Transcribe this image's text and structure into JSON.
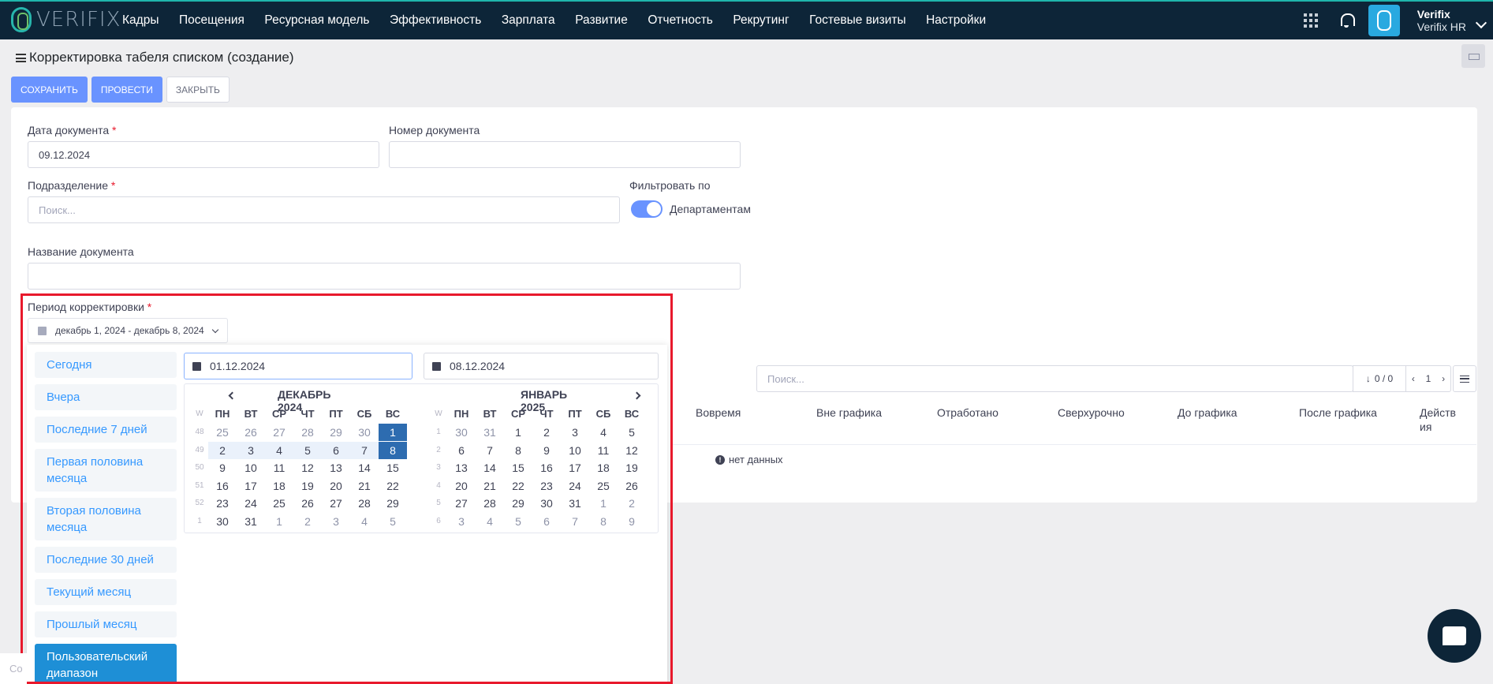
{
  "nav": {
    "logo": "VERIFIX",
    "items": [
      "Кадры",
      "Посещения",
      "Ресурсная модель",
      "Эффективность",
      "Зарплата",
      "Развитие",
      "Отчетность",
      "Рекрутинг",
      "Гостевые визиты",
      "Настройки"
    ],
    "user_name": "Verifix",
    "user_company": "Verifix HR"
  },
  "page": {
    "title": "Корректировка табеля списком (создание)",
    "save": "СОХРАНИТЬ",
    "post": "ПРОВЕСТИ",
    "close": "ЗАКРЫТЬ"
  },
  "form": {
    "doc_date_label": "Дата документа",
    "doc_date_value": "09.12.2024",
    "doc_number_label": "Номер документа",
    "doc_number_value": "",
    "division_label": "Подразделение",
    "division_placeholder": "Поиск...",
    "filter_label": "Фильтровать по",
    "filter_toggle_label": "Департаментам",
    "doc_name_label": "Название документа",
    "doc_name_value": "",
    "period_label": "Период корректировки",
    "period_value": "декабрь 1, 2024 - декабрь 8, 2024",
    "required_mark": "*"
  },
  "table": {
    "search_placeholder": "Поиск...",
    "counter": "0 / 0",
    "page": "1",
    "columns": [
      "Вовремя",
      "Вне графика",
      "Отработано",
      "Сверхурочно",
      "До графика",
      "После графика",
      "Действия"
    ],
    "empty_text": "нет данных"
  },
  "daterange": {
    "ranges": [
      "Сегодня",
      "Вчера",
      "Последние 7 дней",
      "Первая половина месяца",
      "Вторая половина месяца",
      "Последние 30 дней",
      "Текущий месяц",
      "Прошлый месяц",
      "Пользовательский диапазон"
    ],
    "active_range": "Пользовательский диапазон",
    "start": "01.12.2024",
    "end": "08.12.2024",
    "dow": [
      "W",
      "ПН",
      "ВТ",
      "СР",
      "ЧТ",
      "ПТ",
      "СБ",
      "ВС"
    ],
    "months": [
      {
        "title": "ДЕКАБРЬ 2024",
        "weeks": [
          {
            "w": "48",
            "days": [
              [
                "25",
                "off"
              ],
              [
                "26",
                "off"
              ],
              [
                "27",
                "off"
              ],
              [
                "28",
                "off"
              ],
              [
                "29",
                "off"
              ],
              [
                "30",
                "off"
              ],
              [
                "1",
                "sel"
              ]
            ]
          },
          {
            "w": "49",
            "days": [
              [
                "2",
                "inrange"
              ],
              [
                "3",
                "inrange"
              ],
              [
                "4",
                "inrange"
              ],
              [
                "5",
                "inrange"
              ],
              [
                "6",
                "inrange"
              ],
              [
                "7",
                "inrange"
              ],
              [
                "8",
                "sel"
              ]
            ]
          },
          {
            "w": "50",
            "days": [
              [
                "9",
                ""
              ],
              [
                "10",
                ""
              ],
              [
                "11",
                ""
              ],
              [
                "12",
                ""
              ],
              [
                "13",
                ""
              ],
              [
                "14",
                ""
              ],
              [
                "15",
                ""
              ]
            ]
          },
          {
            "w": "51",
            "days": [
              [
                "16",
                ""
              ],
              [
                "17",
                ""
              ],
              [
                "18",
                ""
              ],
              [
                "19",
                ""
              ],
              [
                "20",
                ""
              ],
              [
                "21",
                ""
              ],
              [
                "22",
                ""
              ]
            ]
          },
          {
            "w": "52",
            "days": [
              [
                "23",
                ""
              ],
              [
                "24",
                ""
              ],
              [
                "25",
                ""
              ],
              [
                "26",
                ""
              ],
              [
                "27",
                ""
              ],
              [
                "28",
                ""
              ],
              [
                "29",
                ""
              ]
            ]
          },
          {
            "w": "1",
            "days": [
              [
                "30",
                ""
              ],
              [
                "31",
                ""
              ],
              [
                "1",
                "off"
              ],
              [
                "2",
                "off"
              ],
              [
                "3",
                "off"
              ],
              [
                "4",
                "off"
              ],
              [
                "5",
                "off"
              ]
            ]
          }
        ]
      },
      {
        "title": "ЯНВАРЬ 2025",
        "weeks": [
          {
            "w": "1",
            "days": [
              [
                "30",
                "off"
              ],
              [
                "31",
                "off"
              ],
              [
                "1",
                ""
              ],
              [
                "2",
                ""
              ],
              [
                "3",
                ""
              ],
              [
                "4",
                ""
              ],
              [
                "5",
                ""
              ]
            ]
          },
          {
            "w": "2",
            "days": [
              [
                "6",
                ""
              ],
              [
                "7",
                ""
              ],
              [
                "8",
                ""
              ],
              [
                "9",
                ""
              ],
              [
                "10",
                ""
              ],
              [
                "11",
                ""
              ],
              [
                "12",
                ""
              ]
            ]
          },
          {
            "w": "3",
            "days": [
              [
                "13",
                ""
              ],
              [
                "14",
                ""
              ],
              [
                "15",
                ""
              ],
              [
                "16",
                ""
              ],
              [
                "17",
                ""
              ],
              [
                "18",
                ""
              ],
              [
                "19",
                ""
              ]
            ]
          },
          {
            "w": "4",
            "days": [
              [
                "20",
                ""
              ],
              [
                "21",
                ""
              ],
              [
                "22",
                ""
              ],
              [
                "23",
                ""
              ],
              [
                "24",
                ""
              ],
              [
                "25",
                ""
              ],
              [
                "26",
                ""
              ]
            ]
          },
          {
            "w": "5",
            "days": [
              [
                "27",
                ""
              ],
              [
                "28",
                ""
              ],
              [
                "29",
                ""
              ],
              [
                "30",
                ""
              ],
              [
                "31",
                ""
              ],
              [
                "1",
                "off"
              ],
              [
                "2",
                "off"
              ]
            ]
          },
          {
            "w": "6",
            "days": [
              [
                "3",
                "off"
              ],
              [
                "4",
                "off"
              ],
              [
                "5",
                "off"
              ],
              [
                "6",
                "off"
              ],
              [
                "7",
                "off"
              ],
              [
                "8",
                "off"
              ],
              [
                "9",
                "off"
              ]
            ]
          }
        ]
      }
    ]
  },
  "footer": {
    "text": "Co"
  },
  "colors": {
    "nav_bg": "#0d2538",
    "primary": "#6993ff",
    "active_range": "#1e8fd6",
    "selected_day": "#2d6cb0",
    "highlight": "#e8192c"
  }
}
